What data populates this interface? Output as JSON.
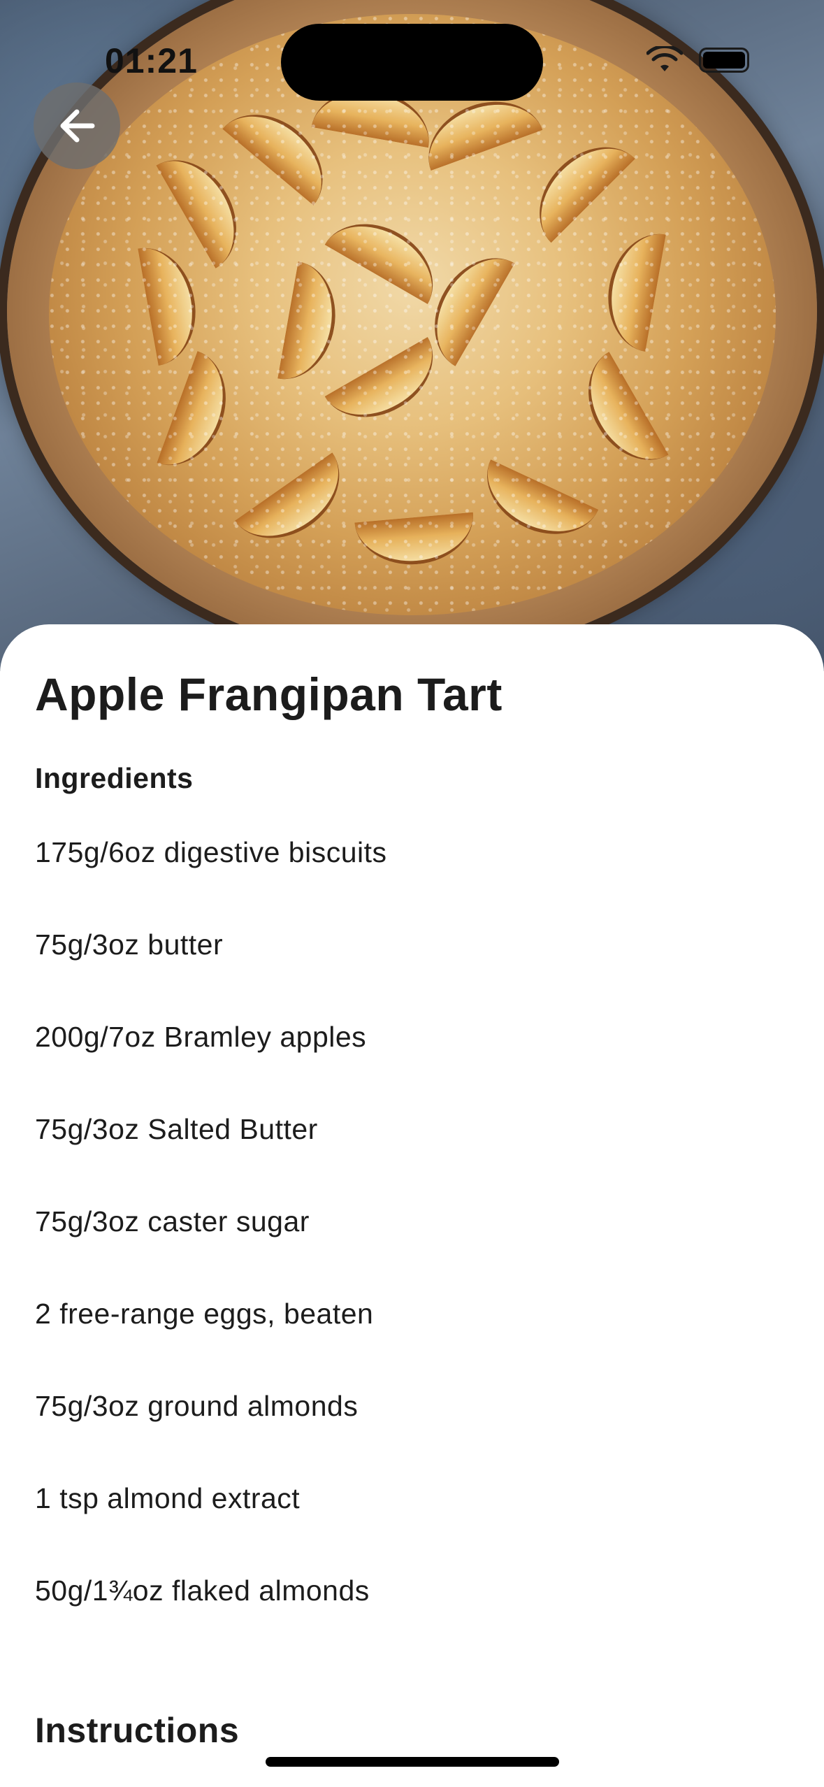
{
  "status_bar": {
    "time": "01:21"
  },
  "icons": {
    "back": "arrow-left-icon",
    "wifi": "wifi-icon",
    "battery": "battery-icon"
  },
  "hero_image": {
    "subject": "apple-tart-photo"
  },
  "recipe": {
    "title": "Apple Frangipan Tart",
    "ingredients_heading": "Ingredients",
    "ingredients": [
      "175g/6oz digestive biscuits",
      "75g/3oz butter",
      "200g/7oz Bramley apples",
      "75g/3oz Salted Butter",
      "75g/3oz caster sugar",
      "2 free-range eggs, beaten",
      "75g/3oz ground almonds",
      "1 tsp almond extract",
      "50g/1¾oz flaked almonds"
    ],
    "instructions_heading": "Instructions"
  },
  "colors": {
    "text": "#1c1c1c",
    "back_button_bg": "#6e6e6e",
    "sheet_bg": "#ffffff"
  }
}
